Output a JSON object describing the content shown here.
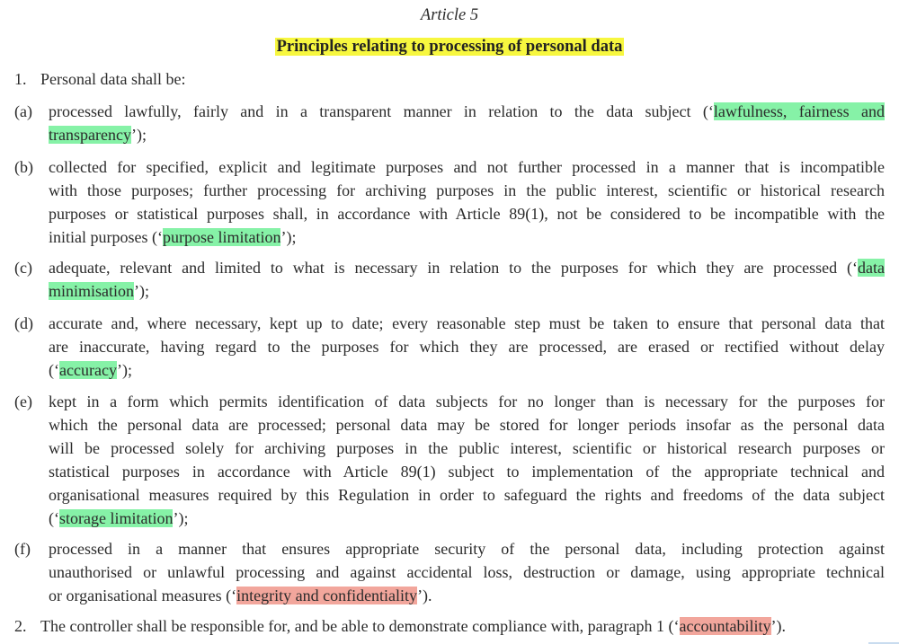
{
  "document": {
    "article_number": "Article 5",
    "article_title": "Principles relating to processing of personal data",
    "highlight_colors": {
      "title": "#f7f73f",
      "green": "#86f2a7",
      "red": "#f2a69c"
    },
    "paragraph_1": {
      "number": "1.",
      "lead": "Personal data shall be:",
      "points": [
        {
          "label": "(a)",
          "lines": [
            {
              "pre": "processed lawfully, fairly and in a transparent manner in relation to the data subject (‘",
              "hl": "lawfulness, fairness and",
              "post": ""
            },
            {
              "pre": "",
              "hl": "transparency",
              "post": "’);"
            }
          ],
          "principle": "lawfulness, fairness and transparency",
          "highlight": "green"
        },
        {
          "label": "(b)",
          "lines": [
            {
              "pre": "collected for specified, explicit and legitimate purposes and not further processed in a manner that is incompatible",
              "hl": "",
              "post": ""
            },
            {
              "pre": "with those purposes; further processing for archiving purposes in the public interest, scientific or historical research",
              "hl": "",
              "post": ""
            },
            {
              "pre": "purposes or statistical purposes shall, in accordance with Article 89(1), not be considered to be incompatible with the",
              "hl": "",
              "post": ""
            },
            {
              "pre": "initial purposes (‘",
              "hl": "purpose limitation",
              "post": "’);"
            }
          ],
          "principle": "purpose limitation",
          "highlight": "green"
        },
        {
          "label": "(c)",
          "lines": [
            {
              "pre": "adequate, relevant and limited to what is necessary in relation to the purposes for which they are processed (‘",
              "hl": "data",
              "post": ""
            },
            {
              "pre": "",
              "hl": "minimisation",
              "post": "’);"
            }
          ],
          "principle": "data minimisation",
          "highlight": "green"
        },
        {
          "label": "(d)",
          "lines": [
            {
              "pre": "accurate and, where necessary, kept up to date; every reasonable step must be taken to ensure that personal data that",
              "hl": "",
              "post": ""
            },
            {
              "pre": "are inaccurate, having regard to the purposes for which they are processed, are erased or rectified without delay",
              "hl": "",
              "post": ""
            },
            {
              "pre": "(‘",
              "hl": "accuracy",
              "post": "’);"
            }
          ],
          "principle": "accuracy",
          "highlight": "green"
        },
        {
          "label": "(e)",
          "lines": [
            {
              "pre": "kept in a form which permits identification of data subjects for no longer than is necessary for the purposes for",
              "hl": "",
              "post": ""
            },
            {
              "pre": "which the personal data are processed; personal data may be stored for longer periods insofar as the personal data",
              "hl": "",
              "post": ""
            },
            {
              "pre": "will be processed solely for archiving purposes in the public interest, scientific or historical research purposes or",
              "hl": "",
              "post": ""
            },
            {
              "pre": "statistical purposes in accordance with Article 89(1) subject to implementation of the appropriate technical and",
              "hl": "",
              "post": ""
            },
            {
              "pre": "organisational measures required by this Regulation in order to safeguard the rights and freedoms of the data subject",
              "hl": "",
              "post": ""
            },
            {
              "pre": "(‘",
              "hl": "storage limitation",
              "post": "’);"
            }
          ],
          "principle": "storage limitation",
          "highlight": "green"
        },
        {
          "label": "(f)",
          "lines": [
            {
              "pre": "processed in a manner that ensures appropriate security of the personal data, including protection against",
              "hl": "",
              "post": ""
            },
            {
              "pre": "unauthorised or unlawful processing and against accidental loss, destruction or damage, using appropriate technical",
              "hl": "",
              "post": ""
            },
            {
              "pre": "or organisational measures (‘",
              "hl": "integrity and confidentiality",
              "post": "’)."
            }
          ],
          "principle": "integrity and confidentiality",
          "highlight": "red"
        }
      ]
    },
    "paragraph_2": {
      "number": "2.",
      "pre": "The controller shall be responsible for, and be able to demonstrate compliance with, paragraph 1 (‘",
      "hl": "accountability",
      "post": "’).",
      "principle": "accountability",
      "highlight": "red"
    }
  }
}
